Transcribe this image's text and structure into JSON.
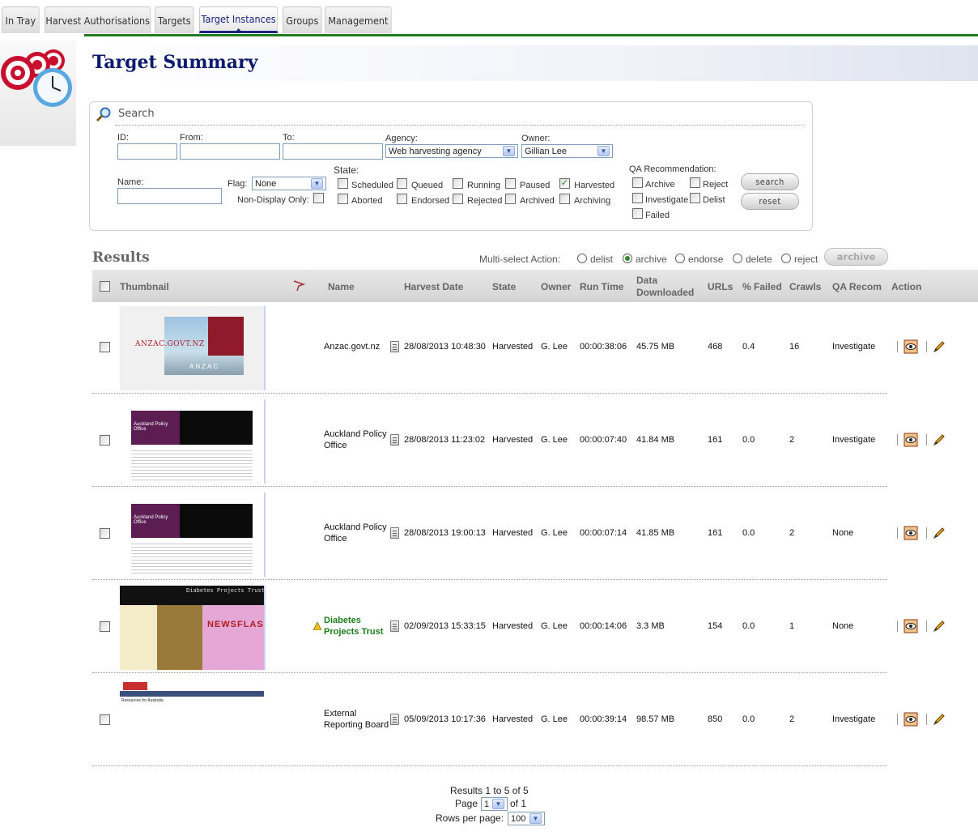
{
  "tabs": [
    {
      "label": "In Tray",
      "active": false
    },
    {
      "label": "Harvest Authorisations",
      "active": false
    },
    {
      "label": "Targets",
      "active": false
    },
    {
      "label": "Target Instances",
      "active": true
    },
    {
      "label": "Groups",
      "active": false
    },
    {
      "label": "Management",
      "active": false
    }
  ],
  "page_title": "Target Summary",
  "search": {
    "title": "Search",
    "id_label": "ID:",
    "id_value": "",
    "from_label": "From:",
    "from_value": "",
    "to_label": "To:",
    "to_value": "",
    "agency_label": "Agency:",
    "agency_value": "Web harvesting agency",
    "owner_label": "Owner:",
    "owner_value": "Gillian Lee",
    "name_label": "Name:",
    "name_value": "",
    "flag_label": "Flag:",
    "flag_value": "None",
    "nondisplay_label": "Non-Display Only:",
    "state_label": "State:",
    "states": [
      {
        "label": "Scheduled",
        "checked": false
      },
      {
        "label": "Queued",
        "checked": false
      },
      {
        "label": "Running",
        "checked": false
      },
      {
        "label": "Paused",
        "checked": false
      },
      {
        "label": "Harvested",
        "checked": true
      },
      {
        "label": "Aborted",
        "checked": false
      },
      {
        "label": "Endorsed",
        "checked": false
      },
      {
        "label": "Rejected",
        "checked": false
      },
      {
        "label": "Archived",
        "checked": false
      },
      {
        "label": "Archiving",
        "checked": false
      }
    ],
    "qa_label": "QA Recommendation:",
    "qa_options": [
      {
        "label": "Archive",
        "checked": false
      },
      {
        "label": "Reject",
        "checked": false
      },
      {
        "label": "Investigate",
        "checked": false
      },
      {
        "label": "Delist",
        "checked": false
      },
      {
        "label": "Failed",
        "checked": false
      }
    ],
    "search_btn": "search",
    "reset_btn": "reset"
  },
  "results": {
    "title": "Results",
    "multiselect_label": "Multi-select Action:",
    "actions": [
      {
        "label": "delist",
        "selected": false
      },
      {
        "label": "archive",
        "selected": true
      },
      {
        "label": "endorse",
        "selected": false
      },
      {
        "label": "delete",
        "selected": false
      },
      {
        "label": "reject",
        "selected": false
      }
    ],
    "action_btn": "archive",
    "columns": {
      "thumbnail": "Thumbnail",
      "name": "Name",
      "harvest_date": "Harvest Date",
      "state": "State",
      "owner": "Owner",
      "run_time": "Run Time",
      "data_downloaded_1": "Data",
      "data_downloaded_2": "Downloaded",
      "urls": "URLs",
      "failed": "% Failed",
      "crawls": "Crawls",
      "qa": "QA Recom",
      "action": "Action"
    },
    "rows": [
      {
        "name1": "Anzac.govt.nz",
        "name2": "",
        "warn": false,
        "date": "28/08/2013 10:48:30",
        "state": "Harvested",
        "owner": "G. Lee",
        "run": "00:00:38:06",
        "data": "45.75 MB",
        "urls": "468",
        "failed": "0.4",
        "crawls": "16",
        "qa": "Investigate",
        "thumb_text": "ANZAC.GOVT.NZ",
        "thumb_sub": "ANZAC"
      },
      {
        "name1": "Auckland Policy",
        "name2": "Office",
        "warn": false,
        "date": "28/08/2013 11:23:02",
        "state": "Harvested",
        "owner": "G. Lee",
        "run": "00:00:07:40",
        "data": "41.84 MB",
        "urls": "161",
        "failed": "0.0",
        "crawls": "2",
        "qa": "Investigate",
        "thumb_text": "Auckland Policy Office"
      },
      {
        "name1": "Auckland Policy",
        "name2": "Office",
        "warn": false,
        "date": "28/08/2013 19:00:13",
        "state": "Harvested",
        "owner": "G. Lee",
        "run": "00:00:07:14",
        "data": "41.85 MB",
        "urls": "161",
        "failed": "0.0",
        "crawls": "2",
        "qa": "None",
        "thumb_text": "Auckland Policy Office"
      },
      {
        "name1": "Diabetes",
        "name2": "Projects Trust",
        "warn": true,
        "date": "02/09/2013 15:33:15",
        "state": "Harvested",
        "owner": "G. Lee",
        "run": "00:00:14:06",
        "data": "3.3 MB",
        "urls": "154",
        "failed": "0.0",
        "crawls": "1",
        "qa": "None",
        "thumb_text": "Diabetes Projects Trust",
        "thumb_sub": "NEWSFLASH"
      },
      {
        "name1": "External",
        "name2": "Reporting Board",
        "warn": false,
        "date": "05/09/2013 10:17:36",
        "state": "Harvested",
        "owner": "G. Lee",
        "run": "00:00:39:14",
        "data": "98.57 MB",
        "urls": "850",
        "failed": "0.0",
        "crawls": "2",
        "qa": "Investigate",
        "thumb_text": "Resources for Australia"
      }
    ]
  },
  "pager": {
    "summary": "Results 1 to 5 of 5",
    "page_label": "Page",
    "page_value": "1",
    "page_of": "of 1",
    "rows_label": "Rows per page:",
    "rows_value": "100"
  },
  "colors": {
    "accent": "#1a237e",
    "green": "#1e7d1e",
    "warn_name": "#1a7d1a"
  }
}
